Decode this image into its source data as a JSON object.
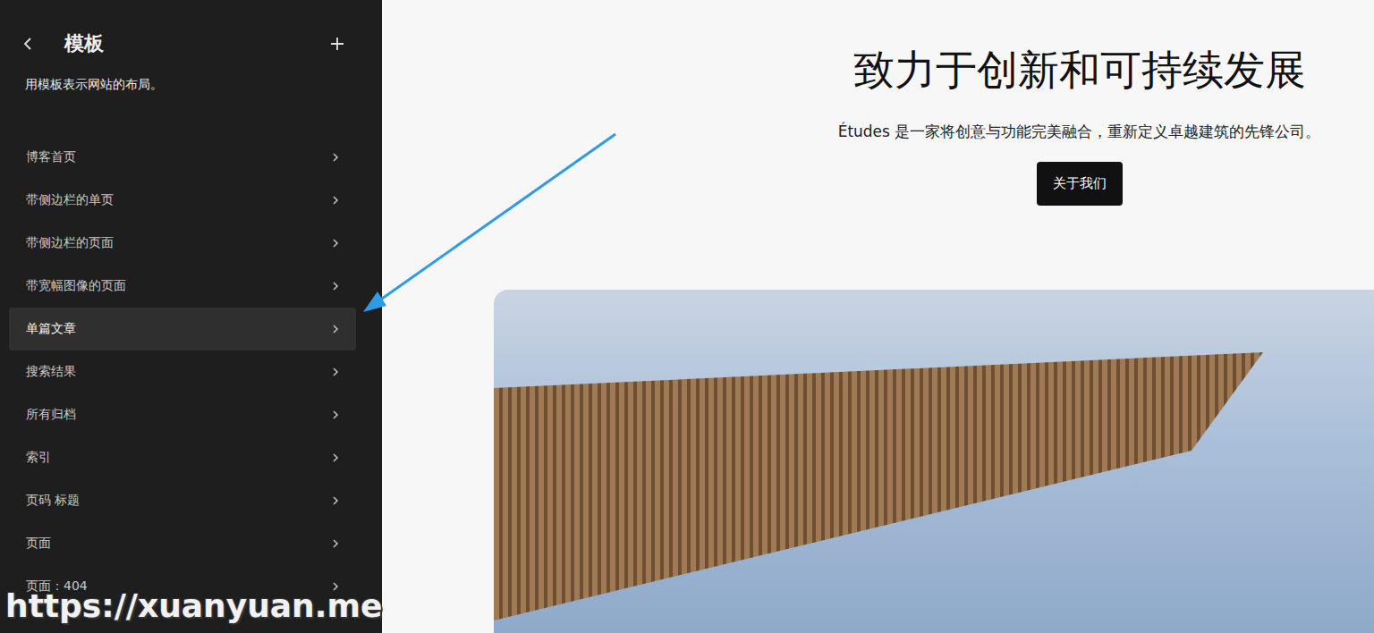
{
  "sidebar": {
    "title": "模板",
    "description": "用模板表示网站的布局。",
    "items": [
      {
        "label": "博客首页",
        "selected": false
      },
      {
        "label": "带侧边栏的单页",
        "selected": false
      },
      {
        "label": "带侧边栏的页面",
        "selected": false
      },
      {
        "label": "带宽幅图像的页面",
        "selected": false
      },
      {
        "label": "单篇文章",
        "selected": true
      },
      {
        "label": "搜索结果",
        "selected": false
      },
      {
        "label": "所有归档",
        "selected": false
      },
      {
        "label": "索引",
        "selected": false
      },
      {
        "label": "页码 标题",
        "selected": false
      },
      {
        "label": "页面",
        "selected": false
      },
      {
        "label": "页面：404",
        "selected": false
      }
    ]
  },
  "hero": {
    "heading": "致力于创新和可持续发展",
    "text": "Études 是一家将创意与功能完美融合，重新定义卓越建筑的先锋公司。",
    "button": "关于我们"
  },
  "watermark": "https://xuanyuan.me"
}
